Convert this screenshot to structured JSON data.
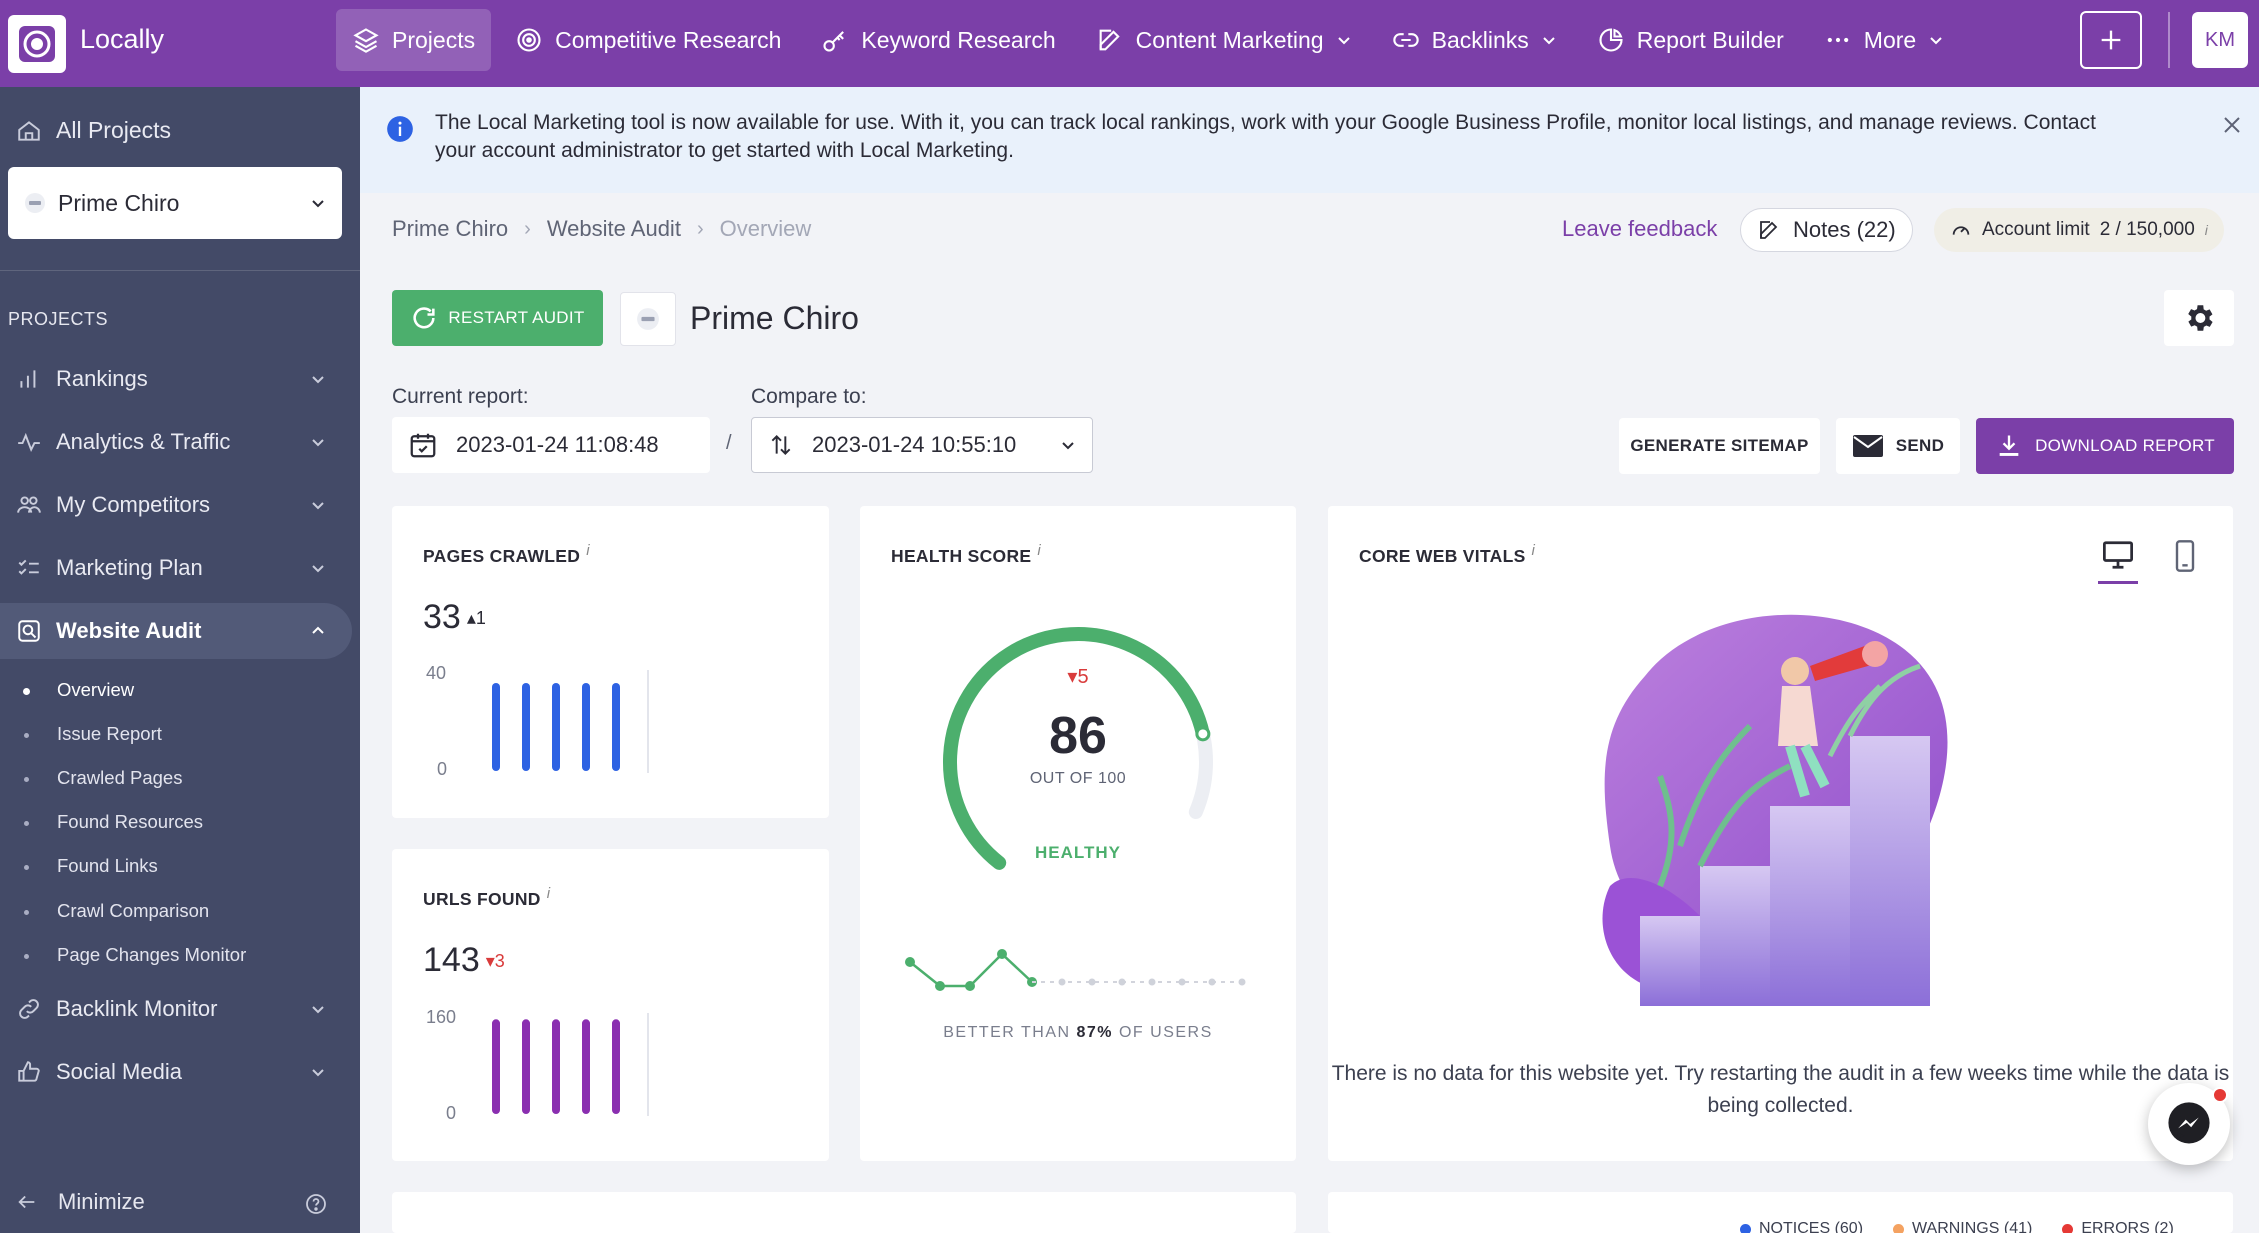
{
  "app": {
    "name": "Locally"
  },
  "topnav": {
    "items": [
      {
        "label": "Projects",
        "icon": "layers-icon",
        "active": true
      },
      {
        "label": "Competitive Research",
        "icon": "target-icon"
      },
      {
        "label": "Keyword Research",
        "icon": "key-icon"
      },
      {
        "label": "Content Marketing",
        "icon": "edit-icon",
        "dropdown": true
      },
      {
        "label": "Backlinks",
        "icon": "link-icon",
        "dropdown": true
      },
      {
        "label": "Report Builder",
        "icon": "pie-chart-icon"
      },
      {
        "label": "More",
        "icon": "dots-icon",
        "dropdown": true
      }
    ],
    "avatar": "KM"
  },
  "sidebar": {
    "all_projects": "All Projects",
    "project_select": "Prime Chiro",
    "section_label": "PROJECTS",
    "items": [
      {
        "label": "Rankings",
        "icon": "bar-chart-icon"
      },
      {
        "label": "Analytics & Traffic",
        "icon": "activity-icon"
      },
      {
        "label": "My Competitors",
        "icon": "users-icon"
      },
      {
        "label": "Marketing Plan",
        "icon": "checklist-icon"
      },
      {
        "label": "Website Audit",
        "icon": "audit-icon",
        "open": true
      },
      {
        "label": "Backlink Monitor",
        "icon": "link-icon"
      },
      {
        "label": "Social Media",
        "icon": "thumbs-up-icon"
      }
    ],
    "subitems": [
      "Overview",
      "Issue Report",
      "Crawled Pages",
      "Found Resources",
      "Found Links",
      "Crawl Comparison",
      "Page Changes Monitor"
    ],
    "minimize": "Minimize"
  },
  "banner": {
    "text": "The Local Marketing tool is now available for use. With it, you can track local rankings, work with your Google Business Profile, monitor local listings, and manage reviews. Contact your account administrator to get started with Local Marketing."
  },
  "breadcrumb": [
    "Prime Chiro",
    "Website Audit",
    "Overview"
  ],
  "header": {
    "feedback": "Leave feedback",
    "notes": "Notes (22)",
    "limit_label": "Account limit",
    "limit_value": "2 / 150,000",
    "restart": "RESTART AUDIT",
    "project_title": "Prime Chiro"
  },
  "reports": {
    "current_label": "Current report:",
    "current_value": "2023-01-24 11:08:48",
    "compare_label": "Compare to:",
    "compare_value": "2023-01-24 10:55:10",
    "generate_sitemap": "GENERATE SITEMAP",
    "send": "SEND",
    "download": "DOWNLOAD REPORT"
  },
  "pages_crawled": {
    "title": "PAGES CRAWLED",
    "value": "33",
    "delta": "1",
    "ymax": "40",
    "ymin": "0",
    "bars": [
      33,
      33,
      33,
      33,
      33
    ],
    "color": "#2d62e3"
  },
  "urls_found": {
    "title": "URLS FOUND",
    "value": "143",
    "delta": "3",
    "ymax": "160",
    "ymin": "0",
    "bars": [
      143,
      143,
      143,
      143,
      143
    ],
    "color": "#8a2fb0"
  },
  "health": {
    "title": "HEALTH SCORE",
    "score": "86",
    "score_value": 86,
    "delta": "5",
    "out_of": "OUT OF 100",
    "status": "HEALTHY",
    "better_prefix": "BETTER THAN",
    "better_value": "87%",
    "better_suffix": "OF USERS",
    "color": "#4caf6d"
  },
  "cwv": {
    "title": "CORE WEB VITALS",
    "empty_text": "There is no data for this website yet. Try restarting the audit in a few weeks time while the data is being collected."
  },
  "legend": [
    {
      "label": "NOTICES (60)",
      "color": "#2d62e3"
    },
    {
      "label": "WARNINGS (41)",
      "color": "#f4a261"
    },
    {
      "label": "ERRORS (2)",
      "color": "#e53935"
    }
  ]
}
